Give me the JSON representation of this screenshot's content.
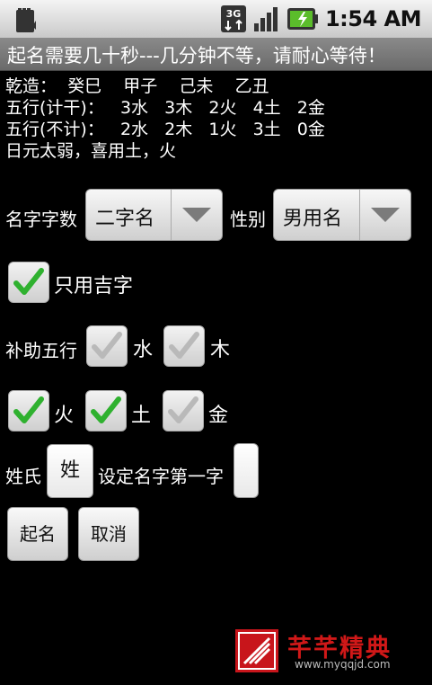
{
  "status_bar": {
    "time": "1:54 AM",
    "network": "3G"
  },
  "title": "起名需要几十秒---几分钟不等，请耐心等待！",
  "info_lines": [
    "乾造：  癸巳    甲子    己未    乙丑",
    "五行(计干)：   3水   3木   2火   4土   2金",
    "五行(不计)：   2水   2木   1火   3土   0金",
    "日元太弱，喜用土，火"
  ],
  "name_count": {
    "label": "名字字数",
    "value": "二字名"
  },
  "gender": {
    "label": "性别",
    "value": "男用名"
  },
  "lucky_only": {
    "label": "只用吉字",
    "checked": true
  },
  "wuxing_label": "补助五行",
  "elements": [
    {
      "label": "水",
      "checked": false
    },
    {
      "label": "木",
      "checked": false
    },
    {
      "label": "火",
      "checked": true
    },
    {
      "label": "土",
      "checked": true
    },
    {
      "label": "金",
      "checked": false
    }
  ],
  "surname": {
    "label": "姓氏",
    "value": "姓"
  },
  "first_char": {
    "label": "设定名字第一字",
    "value": ""
  },
  "buttons": {
    "generate": "起名",
    "cancel": "取消"
  },
  "watermark": {
    "title": "芊芊精典",
    "url": "www.myqqjd.com"
  }
}
